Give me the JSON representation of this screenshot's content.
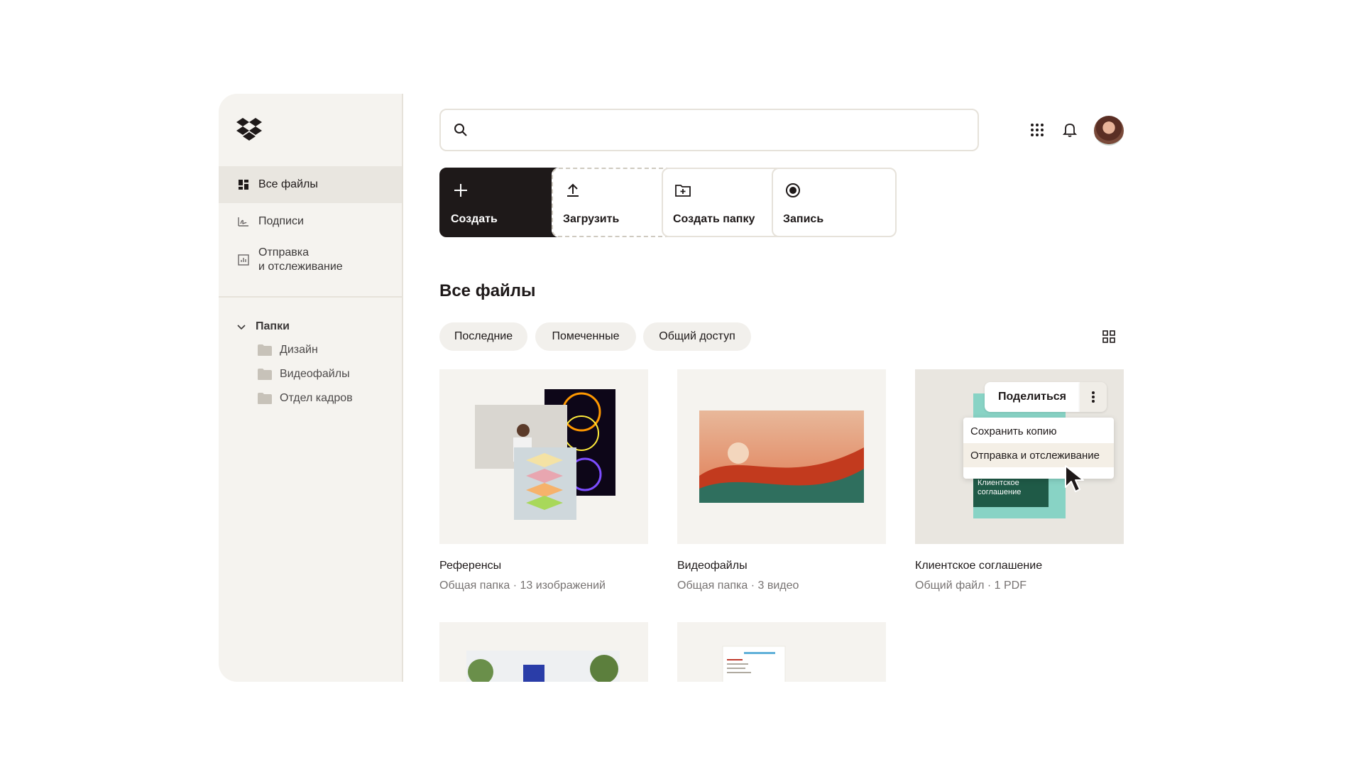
{
  "sidebar": {
    "nav": [
      {
        "label": "Все файлы",
        "icon": "all-files-icon",
        "active": true
      },
      {
        "label": "Подписи",
        "icon": "signature-icon"
      },
      {
        "label_line1": "Отправка",
        "label_line2": "и отслеживание",
        "icon": "chart-icon"
      }
    ],
    "folders_label": "Папки",
    "folders": [
      {
        "label": "Дизайн"
      },
      {
        "label": "Видеофайлы"
      },
      {
        "label": "Отдел кадров"
      }
    ]
  },
  "header": {
    "search_placeholder": "",
    "icons": [
      "apps-grid-icon",
      "bell-icon"
    ]
  },
  "actions": [
    {
      "label": "Создать",
      "icon": "plus-icon"
    },
    {
      "label": "Загрузить",
      "icon": "upload-icon"
    },
    {
      "label": "Создать папку",
      "icon": "folder-plus-icon"
    },
    {
      "label": "Запись",
      "icon": "record-icon"
    }
  ],
  "main": {
    "title": "Все файлы",
    "filters": [
      "Последние",
      "Помеченные",
      "Общий доступ"
    ]
  },
  "cards": [
    {
      "name": "Референсы",
      "meta": "Общая папка · 13 изображений"
    },
    {
      "name": "Видеофайлы",
      "meta": "Общая папка · 3 видео"
    },
    {
      "name": "Клиентское соглашение",
      "meta": "Общий файл · 1 PDF",
      "thumb_text_line1": "Клиентское",
      "thumb_text_line2": "соглашение"
    }
  ],
  "share_popup": {
    "share_label": "Поделиться",
    "menu": [
      "Сохранить копию",
      "Отправка и отслеживание"
    ]
  },
  "colors": {
    "accent_dark": "#1e1919",
    "sidebar_bg": "#f5f3ef",
    "card_bg": "#f5f3ef",
    "agreement_green": "#1f5a47",
    "agreement_teal": "#88d3c5"
  }
}
